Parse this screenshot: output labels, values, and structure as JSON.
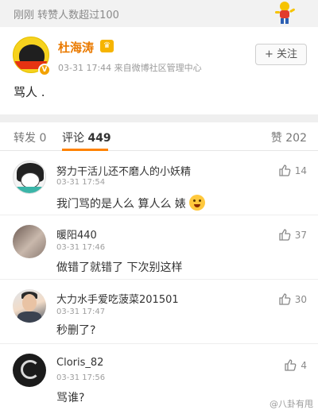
{
  "banner": {
    "text": "刚刚  转赞人数超过100",
    "mascot_icon": "weibo-mascot-icon"
  },
  "post": {
    "username": "杜海涛",
    "meta": "03-31 17:44  来自微博社区管理中心",
    "follow_label": "+ 关注",
    "content": "骂人 ."
  },
  "tabs": {
    "repost_label": "转发",
    "repost_count": "0",
    "comments_label": "评论",
    "comments_count": "449",
    "likes_label": "赞",
    "likes_count": "202"
  },
  "comments": [
    {
      "name": "努力干活儿还不磨人的小妖精",
      "time": "03-31 17:54",
      "text": "我门骂的是人么 算人么    婊",
      "likes": "14"
    },
    {
      "name": "暖阳440",
      "time": "03-31 17:46",
      "text": "做错了就错了 下次别这样",
      "likes": "37"
    },
    {
      "name": "大力水手爱吃菠菜201501",
      "time": "03-31 17:47",
      "text": "秒删了?",
      "likes": "30"
    },
    {
      "name": "Cloris_82",
      "time": "03-31 17:56",
      "text": "骂谁?",
      "likes": "4"
    }
  ],
  "watermark": "@八卦有甩",
  "colors": {
    "accent": "#ff8200",
    "username": "#ea7a00",
    "badge": "#f3a200"
  }
}
